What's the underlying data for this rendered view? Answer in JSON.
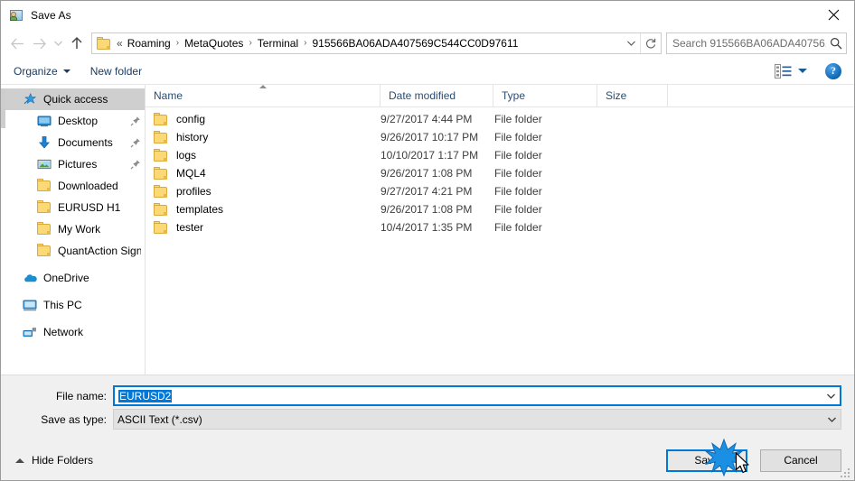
{
  "window": {
    "title": "Save As",
    "icon": "save-as-app-icon",
    "close_label": "✕"
  },
  "nav": {
    "back_icon": "arrow-left-icon",
    "forward_icon": "arrow-right-icon",
    "recent_icon": "chevron-down-icon",
    "up_icon": "arrow-up-icon",
    "address": {
      "folder_icon": "folder-icon",
      "lead": "«",
      "crumbs": [
        "Roaming",
        "MetaQuotes",
        "Terminal",
        "915566BA06ADA407569C544CC0D97611"
      ],
      "separator": "›",
      "dropdown_icon": "chevron-down-icon",
      "refresh_icon": "refresh-icon"
    },
    "search": {
      "placeholder": "Search 915566BA06ADA40756...",
      "icon": "search-icon"
    }
  },
  "toolbar": {
    "organize_label": "Organize",
    "new_folder_label": "New folder",
    "view_icon": "view-layout-icon",
    "help_label": "?"
  },
  "sidebar": {
    "items": [
      {
        "label": "Quick access",
        "icon": "star-icon",
        "indent": 0,
        "selected": true,
        "pinned": false
      },
      {
        "label": "Desktop",
        "icon": "desktop-icon",
        "indent": 1,
        "selected": false,
        "pinned": true
      },
      {
        "label": "Documents",
        "icon": "documents-icon",
        "indent": 1,
        "selected": false,
        "pinned": true
      },
      {
        "label": "Pictures",
        "icon": "pictures-icon",
        "indent": 1,
        "selected": false,
        "pinned": true
      },
      {
        "label": "Downloaded",
        "icon": "folder-icon",
        "indent": 1,
        "selected": false,
        "pinned": false
      },
      {
        "label": "EURUSD H1",
        "icon": "folder-icon",
        "indent": 1,
        "selected": false,
        "pinned": false
      },
      {
        "label": "My Work",
        "icon": "folder-icon",
        "indent": 1,
        "selected": false,
        "pinned": false
      },
      {
        "label": "QuantAction Signal",
        "icon": "folder-icon",
        "indent": 1,
        "selected": false,
        "pinned": false
      },
      {
        "label": "OneDrive",
        "icon": "onedrive-cloud-icon",
        "indent": 0,
        "selected": false,
        "pinned": false,
        "gap_before": true
      },
      {
        "label": "This PC",
        "icon": "this-pc-icon",
        "indent": 0,
        "selected": false,
        "pinned": false,
        "gap_before": true
      },
      {
        "label": "Network",
        "icon": "network-icon",
        "indent": 0,
        "selected": false,
        "pinned": false,
        "gap_before": true
      }
    ]
  },
  "filelist": {
    "columns": [
      "Name",
      "Date modified",
      "Type",
      "Size"
    ],
    "sorted_column": "Name",
    "sort_direction": "ascending",
    "rows": [
      {
        "name": "config",
        "date": "9/27/2017 4:44 PM",
        "type": "File folder",
        "size": ""
      },
      {
        "name": "history",
        "date": "9/26/2017 10:17 PM",
        "type": "File folder",
        "size": ""
      },
      {
        "name": "logs",
        "date": "10/10/2017 1:17 PM",
        "type": "File folder",
        "size": ""
      },
      {
        "name": "MQL4",
        "date": "9/26/2017 1:08 PM",
        "type": "File folder",
        "size": ""
      },
      {
        "name": "profiles",
        "date": "9/27/2017 4:21 PM",
        "type": "File folder",
        "size": ""
      },
      {
        "name": "templates",
        "date": "9/26/2017 1:08 PM",
        "type": "File folder",
        "size": ""
      },
      {
        "name": "tester",
        "date": "10/4/2017 1:35 PM",
        "type": "File folder",
        "size": ""
      }
    ]
  },
  "form": {
    "filename_label": "File name:",
    "filename_value": "EURUSD2",
    "filetype_label": "Save as type:",
    "filetype_value": "ASCII Text (*.csv)",
    "dropdown_icon": "chevron-down-icon"
  },
  "footer": {
    "hide_folders_label": "Hide Folders",
    "hide_folders_icon": "chevron-up-icon",
    "save_label": "Save",
    "cancel_label": "Cancel",
    "resize_grip_icon": "resize-grip-icon"
  },
  "overlay": {
    "click_burst_icon": "click-burst-icon",
    "cursor_icon": "mouse-pointer-icon"
  },
  "colors": {
    "accent": "#0078d7",
    "selection": "#0078d7",
    "folder": "#fcd977",
    "window_bg": "#ffffff",
    "panel_bg": "#f0f0f0"
  }
}
